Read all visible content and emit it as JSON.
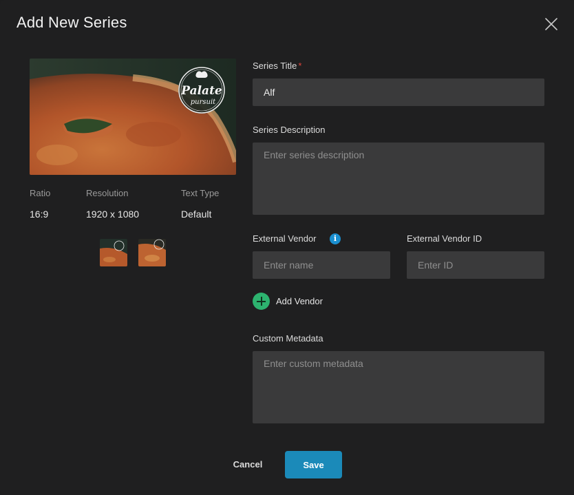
{
  "dialog": {
    "title": "Add New Series",
    "close_icon": "close-icon"
  },
  "artwork": {
    "logo_text_1": "Palate",
    "logo_text_2": "pursuit",
    "details": {
      "ratio_label": "Ratio",
      "ratio_value": "16:9",
      "resolution_label": "Resolution",
      "resolution_value": "1920 x 1080",
      "text_type_label": "Text Type",
      "text_type_value": "Default"
    }
  },
  "form": {
    "series_title": {
      "label": "Series Title",
      "required_mark": "*",
      "value": "Alf"
    },
    "series_description": {
      "label": "Series Description",
      "placeholder": "Enter series description"
    },
    "external_vendor": {
      "label": "External Vendor",
      "info_icon": "i",
      "placeholder": "Enter name"
    },
    "external_vendor_id": {
      "label": "External Vendor ID",
      "placeholder": "Enter ID"
    },
    "add_vendor_label": "Add Vendor",
    "custom_metadata": {
      "label": "Custom Metadata",
      "placeholder": "Enter custom metadata"
    }
  },
  "footer": {
    "cancel_label": "Cancel",
    "save_label": "Save"
  },
  "colors": {
    "accent": "#1b8ab9",
    "add_green": "#2db36f",
    "info_blue": "#1a8fd0",
    "required_red": "#e0453c"
  }
}
